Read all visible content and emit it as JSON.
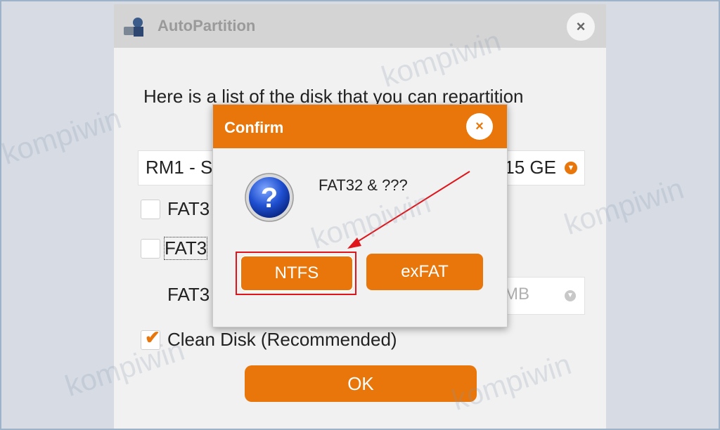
{
  "main_window": {
    "title": "AutoPartition",
    "close_glyph": "×",
    "prompt": "Here is a list of the disk that you can repartition",
    "disk_select": {
      "value_left": "RM1 - S",
      "value_right": "15 GE"
    },
    "options": [
      {
        "label": "FAT3",
        "checked": false
      },
      {
        "label": "FAT3",
        "checked": false
      },
      {
        "label": "FAT3"
      }
    ],
    "size_select_value": "MB",
    "clean_disk": {
      "label": "Clean Disk (Recommended)",
      "checked": true
    },
    "ok_label": "OK"
  },
  "confirm_dialog": {
    "title": "Confirm",
    "close_glyph": "×",
    "message": "FAT32 & ???",
    "buttons": {
      "ntfs": "NTFS",
      "exfat": "exFAT"
    }
  },
  "watermark_text": "kompiwin",
  "colors": {
    "accent": "#e8760a",
    "annotation": "#e0141b"
  }
}
